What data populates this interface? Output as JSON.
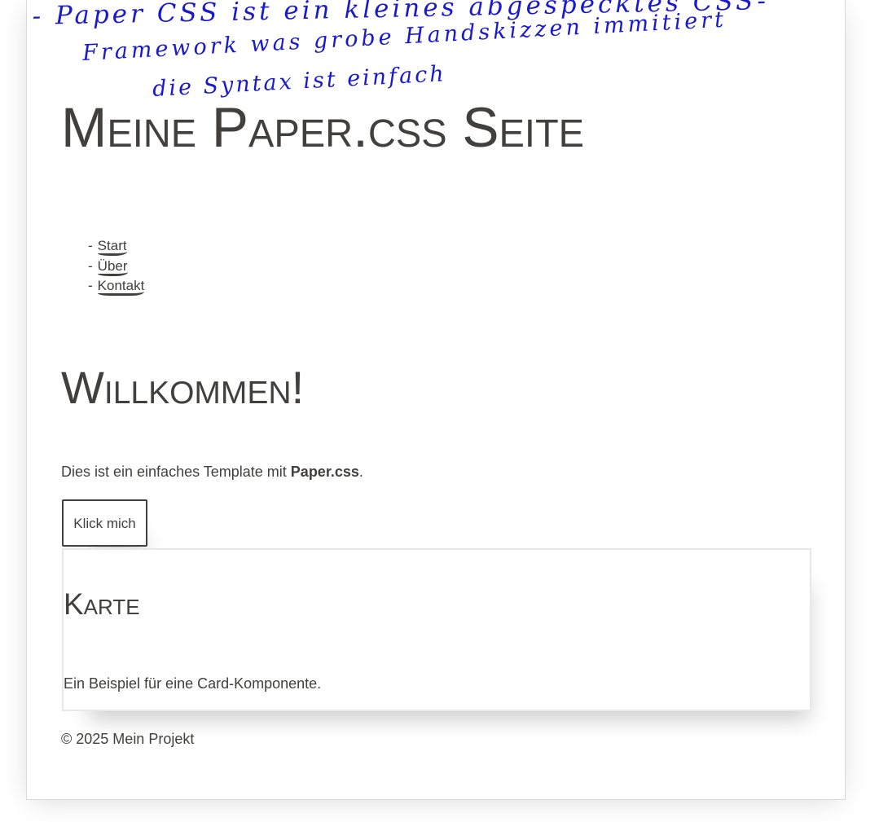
{
  "annotation": {
    "line1": "- Paper CSS   ist ein   kleines abgespecktes  CSS-",
    "line2": "Framework   was  grobe Handskizzen   immitiert",
    "line3": "die  Syntax  ist  einfach",
    "color": "#1a1acc"
  },
  "header": {
    "title": "Meine Paper.css Seite"
  },
  "nav": {
    "items": [
      {
        "label": "Start"
      },
      {
        "label": "Über"
      },
      {
        "label": "Kontakt"
      }
    ],
    "bullet": "-"
  },
  "main": {
    "heading": "Willkommen!",
    "intro_prefix": "Dies ist ein einfaches Template mit ",
    "intro_bold": "Paper.css",
    "intro_suffix": ".",
    "button_label": "Klick mich"
  },
  "card": {
    "title": "Karte",
    "text": "Ein Beispiel für eine Card-Komponente."
  },
  "footer": {
    "text": "© 2025 Mein Projekt"
  }
}
